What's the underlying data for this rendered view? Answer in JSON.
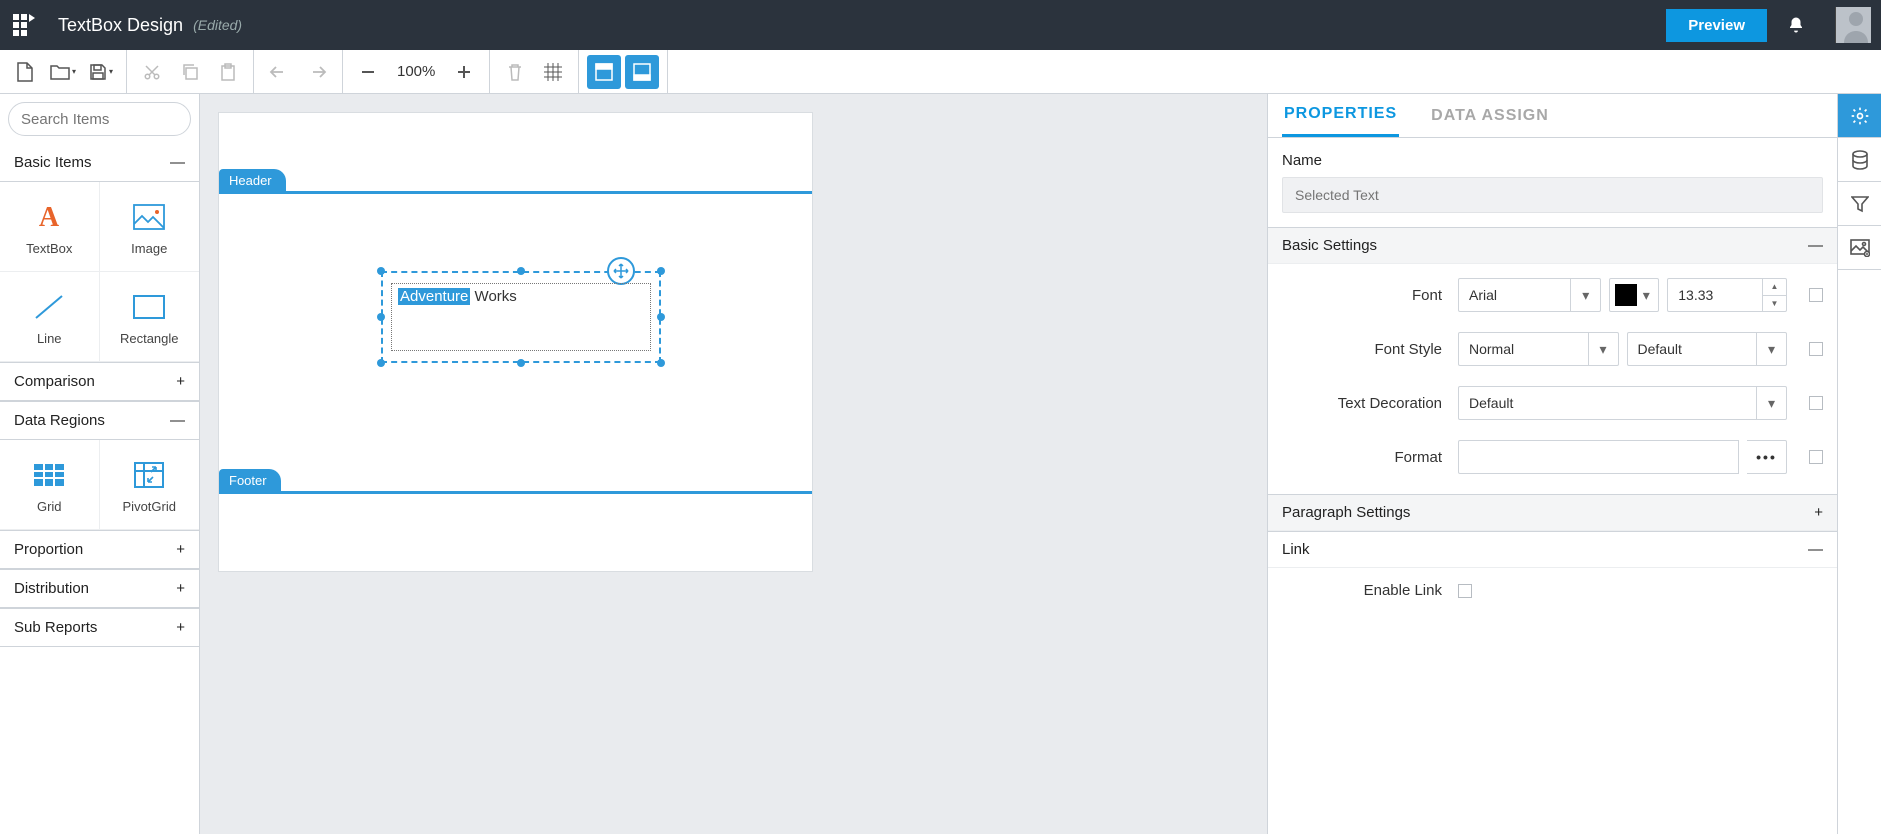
{
  "header": {
    "title": "TextBox Design",
    "edited_label": "(Edited)",
    "preview_label": "Preview"
  },
  "toolbar": {
    "zoom": "100%"
  },
  "sidebar": {
    "search_placeholder": "Search Items",
    "sections": [
      {
        "label": "Basic Items",
        "expanded": true,
        "items": [
          {
            "label": "TextBox"
          },
          {
            "label": "Image"
          },
          {
            "label": "Line"
          },
          {
            "label": "Rectangle"
          }
        ]
      },
      {
        "label": "Comparison",
        "expanded": false
      },
      {
        "label": "Data Regions",
        "expanded": true,
        "items": [
          {
            "label": "Grid"
          },
          {
            "label": "PivotGrid"
          }
        ]
      },
      {
        "label": "Proportion",
        "expanded": false
      },
      {
        "label": "Distribution",
        "expanded": false
      },
      {
        "label": "Sub Reports",
        "expanded": false
      }
    ]
  },
  "canvas": {
    "header_label": "Header",
    "footer_label": "Footer",
    "textbox": {
      "highlighted": "Adventure",
      "rest": " Works"
    }
  },
  "properties": {
    "tabs": {
      "properties": "PROPERTIES",
      "data_assign": "DATA ASSIGN"
    },
    "name_label": "Name",
    "name_placeholder": "Selected Text",
    "basic_settings": {
      "title": "Basic Settings",
      "font_label": "Font",
      "font_value": "Arial",
      "font_size": "13.33",
      "font_color": "#000000",
      "font_style_label": "Font Style",
      "font_style_value": "Normal",
      "font_style_value2": "Default",
      "text_decoration_label": "Text Decoration",
      "text_decoration_value": "Default",
      "format_label": "Format",
      "format_value": ""
    },
    "paragraph_title": "Paragraph Settings",
    "link": {
      "title": "Link",
      "enable_label": "Enable Link"
    }
  }
}
